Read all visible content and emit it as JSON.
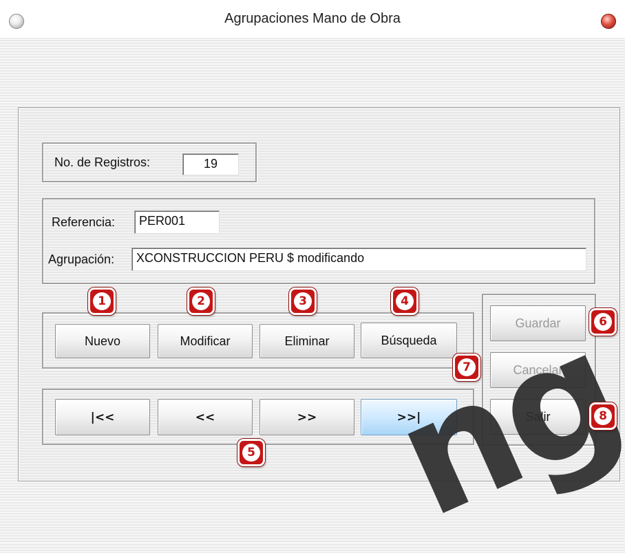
{
  "window": {
    "title": "Agrupaciones Mano de Obra"
  },
  "registros": {
    "label": "No. de Registros:",
    "value": "19"
  },
  "form": {
    "referencia_label": "Referencia:",
    "referencia_value": "PER001",
    "agrupacion_label": "Agrupación:",
    "agrupacion_value": "XCONSTRUCCION PERU $ modificando"
  },
  "actions": {
    "nuevo": "Nuevo",
    "modificar": "Modificar",
    "eliminar": "Eliminar",
    "busqueda": "Búsqueda"
  },
  "navigation": {
    "first": "|<<",
    "prev": "<<",
    "next": ">>",
    "last": ">>|"
  },
  "side": {
    "guardar": "Guardar",
    "cancelar": "Cancelar",
    "salir": "Salir"
  },
  "badges": [
    "1",
    "2",
    "3",
    "4",
    "5",
    "6",
    "7",
    "8"
  ],
  "watermark_text": "ng",
  "colors": {
    "badge_red": "#c41616",
    "active_button_blue": "#a9d6f7",
    "disabled_text": "#9a9a9a"
  }
}
